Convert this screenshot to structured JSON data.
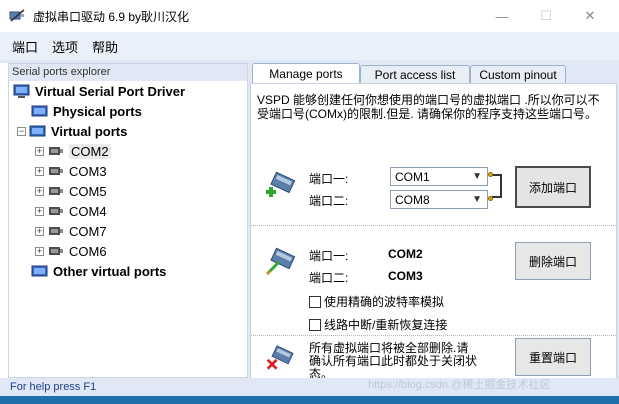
{
  "window": {
    "title": "虚拟串口驱动 6.9 by耿川汉化",
    "min": "—",
    "max": "☐",
    "close": "✕"
  },
  "menu": [
    "端口",
    "选项",
    "帮助"
  ],
  "explorer": {
    "header": "Serial ports explorer",
    "root": "Virtual Serial Port Driver",
    "physical": "Physical ports",
    "virtual": "Virtual ports",
    "ports": [
      "COM2",
      "COM3",
      "COM5",
      "COM4",
      "COM7",
      "COM6"
    ],
    "other": "Other virtual ports",
    "selected": "COM2"
  },
  "tabs": [
    "Manage ports",
    "Port access list",
    "Custom pinout"
  ],
  "panel": {
    "description": "VSPD 能够创建任何你想使用的端口号的虚拟端口 .所以你可以不受端口号(COMx)的限制.但是. 请确保你的程序支持这些端口号。",
    "add": {
      "port1_label": "端口一:",
      "port2_label": "端口二:",
      "port1_value": "COM1",
      "port2_value": "COM8",
      "button": "添加端口"
    },
    "delete": {
      "port1_label": "端口一:",
      "port2_label": "端口二:",
      "port1_value": "COM2",
      "port2_value": "COM3",
      "button": "删除端口",
      "option_baud": "使用精确的波特率模拟",
      "option_reconnect": "线路中断/重新恢复连接"
    },
    "reset": {
      "text": "所有虚拟端口将被全部删除.请确认所有端口此时都处于关闭状态。",
      "button": "重置端口"
    }
  },
  "status": "For help press F1",
  "watermark": "https://blog.csdn.@稀土掘金技术社区"
}
